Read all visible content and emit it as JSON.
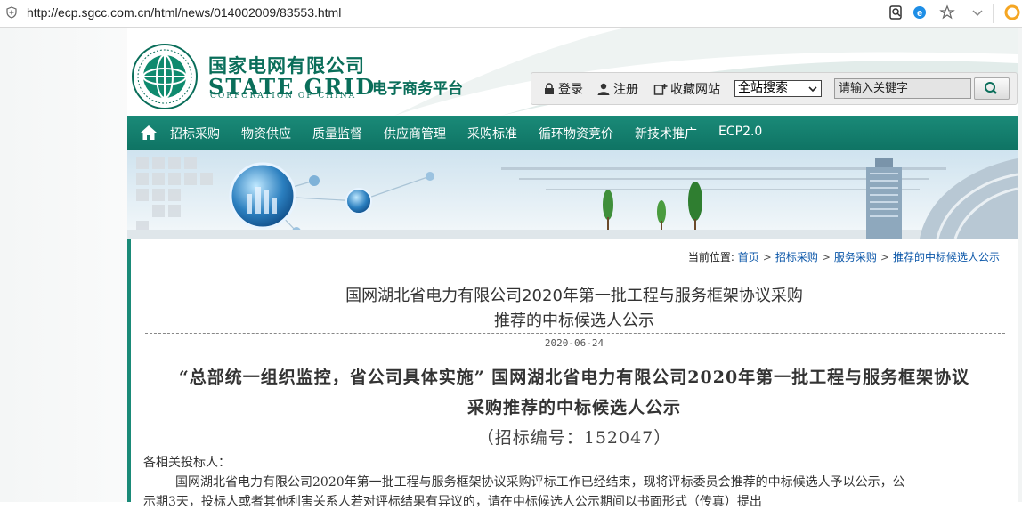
{
  "browser": {
    "url": "http://ecp.sgcc.com.cn/html/news/014002009/83553.html"
  },
  "header": {
    "cn_name": "国家电网有限公司",
    "en_name": "STATE GRID",
    "en_sub": "CORPORATION OF CHINA",
    "platform": "电子商务平台",
    "login_label": "登录",
    "register_label": "注册",
    "favorite_label": "收藏网站",
    "search_scope": "全站搜索",
    "search_placeholder": "请输入关键字"
  },
  "nav": {
    "items": [
      "招标采购",
      "物资供应",
      "质量监督",
      "供应商管理",
      "采购标准",
      "循环物资竞价",
      "新技术推广",
      "ECP2.0"
    ]
  },
  "breadcrumb": {
    "prefix": "当前位置:",
    "items": [
      "首页",
      "招标采购",
      "服务采购",
      "推荐的中标候选人公示"
    ]
  },
  "article": {
    "title_line1": "国网湖北省电力有限公司2020年第一批工程与服务框架协议采购",
    "title_line2": "推荐的中标候选人公示",
    "date": "2020-06-24",
    "heading_line1": "“总部统一组织监控，省公司具体实施” 国网湖北省电力有限公司2020年第一批工程与服务框架协议",
    "heading_line2": "采购推荐的中标候选人公示",
    "tender_code": "（招标编号：152047）",
    "salutation": "各相关投标人：",
    "para1": "国网湖北省电力有限公司2020年第一批工程与服务框架协议采购评标工作已经结束，现将评标委员会推荐的中标候选人予以公示，公",
    "para2": "示期3天，投标人或者其他利害关系人若对评标结果有异议的，请在中标候选人公示期间以书面形式（传真）提出"
  },
  "colors": {
    "brand_green": "#0a6e5a",
    "nav_green": "#1a8a78",
    "link_blue": "#0a56a8"
  }
}
